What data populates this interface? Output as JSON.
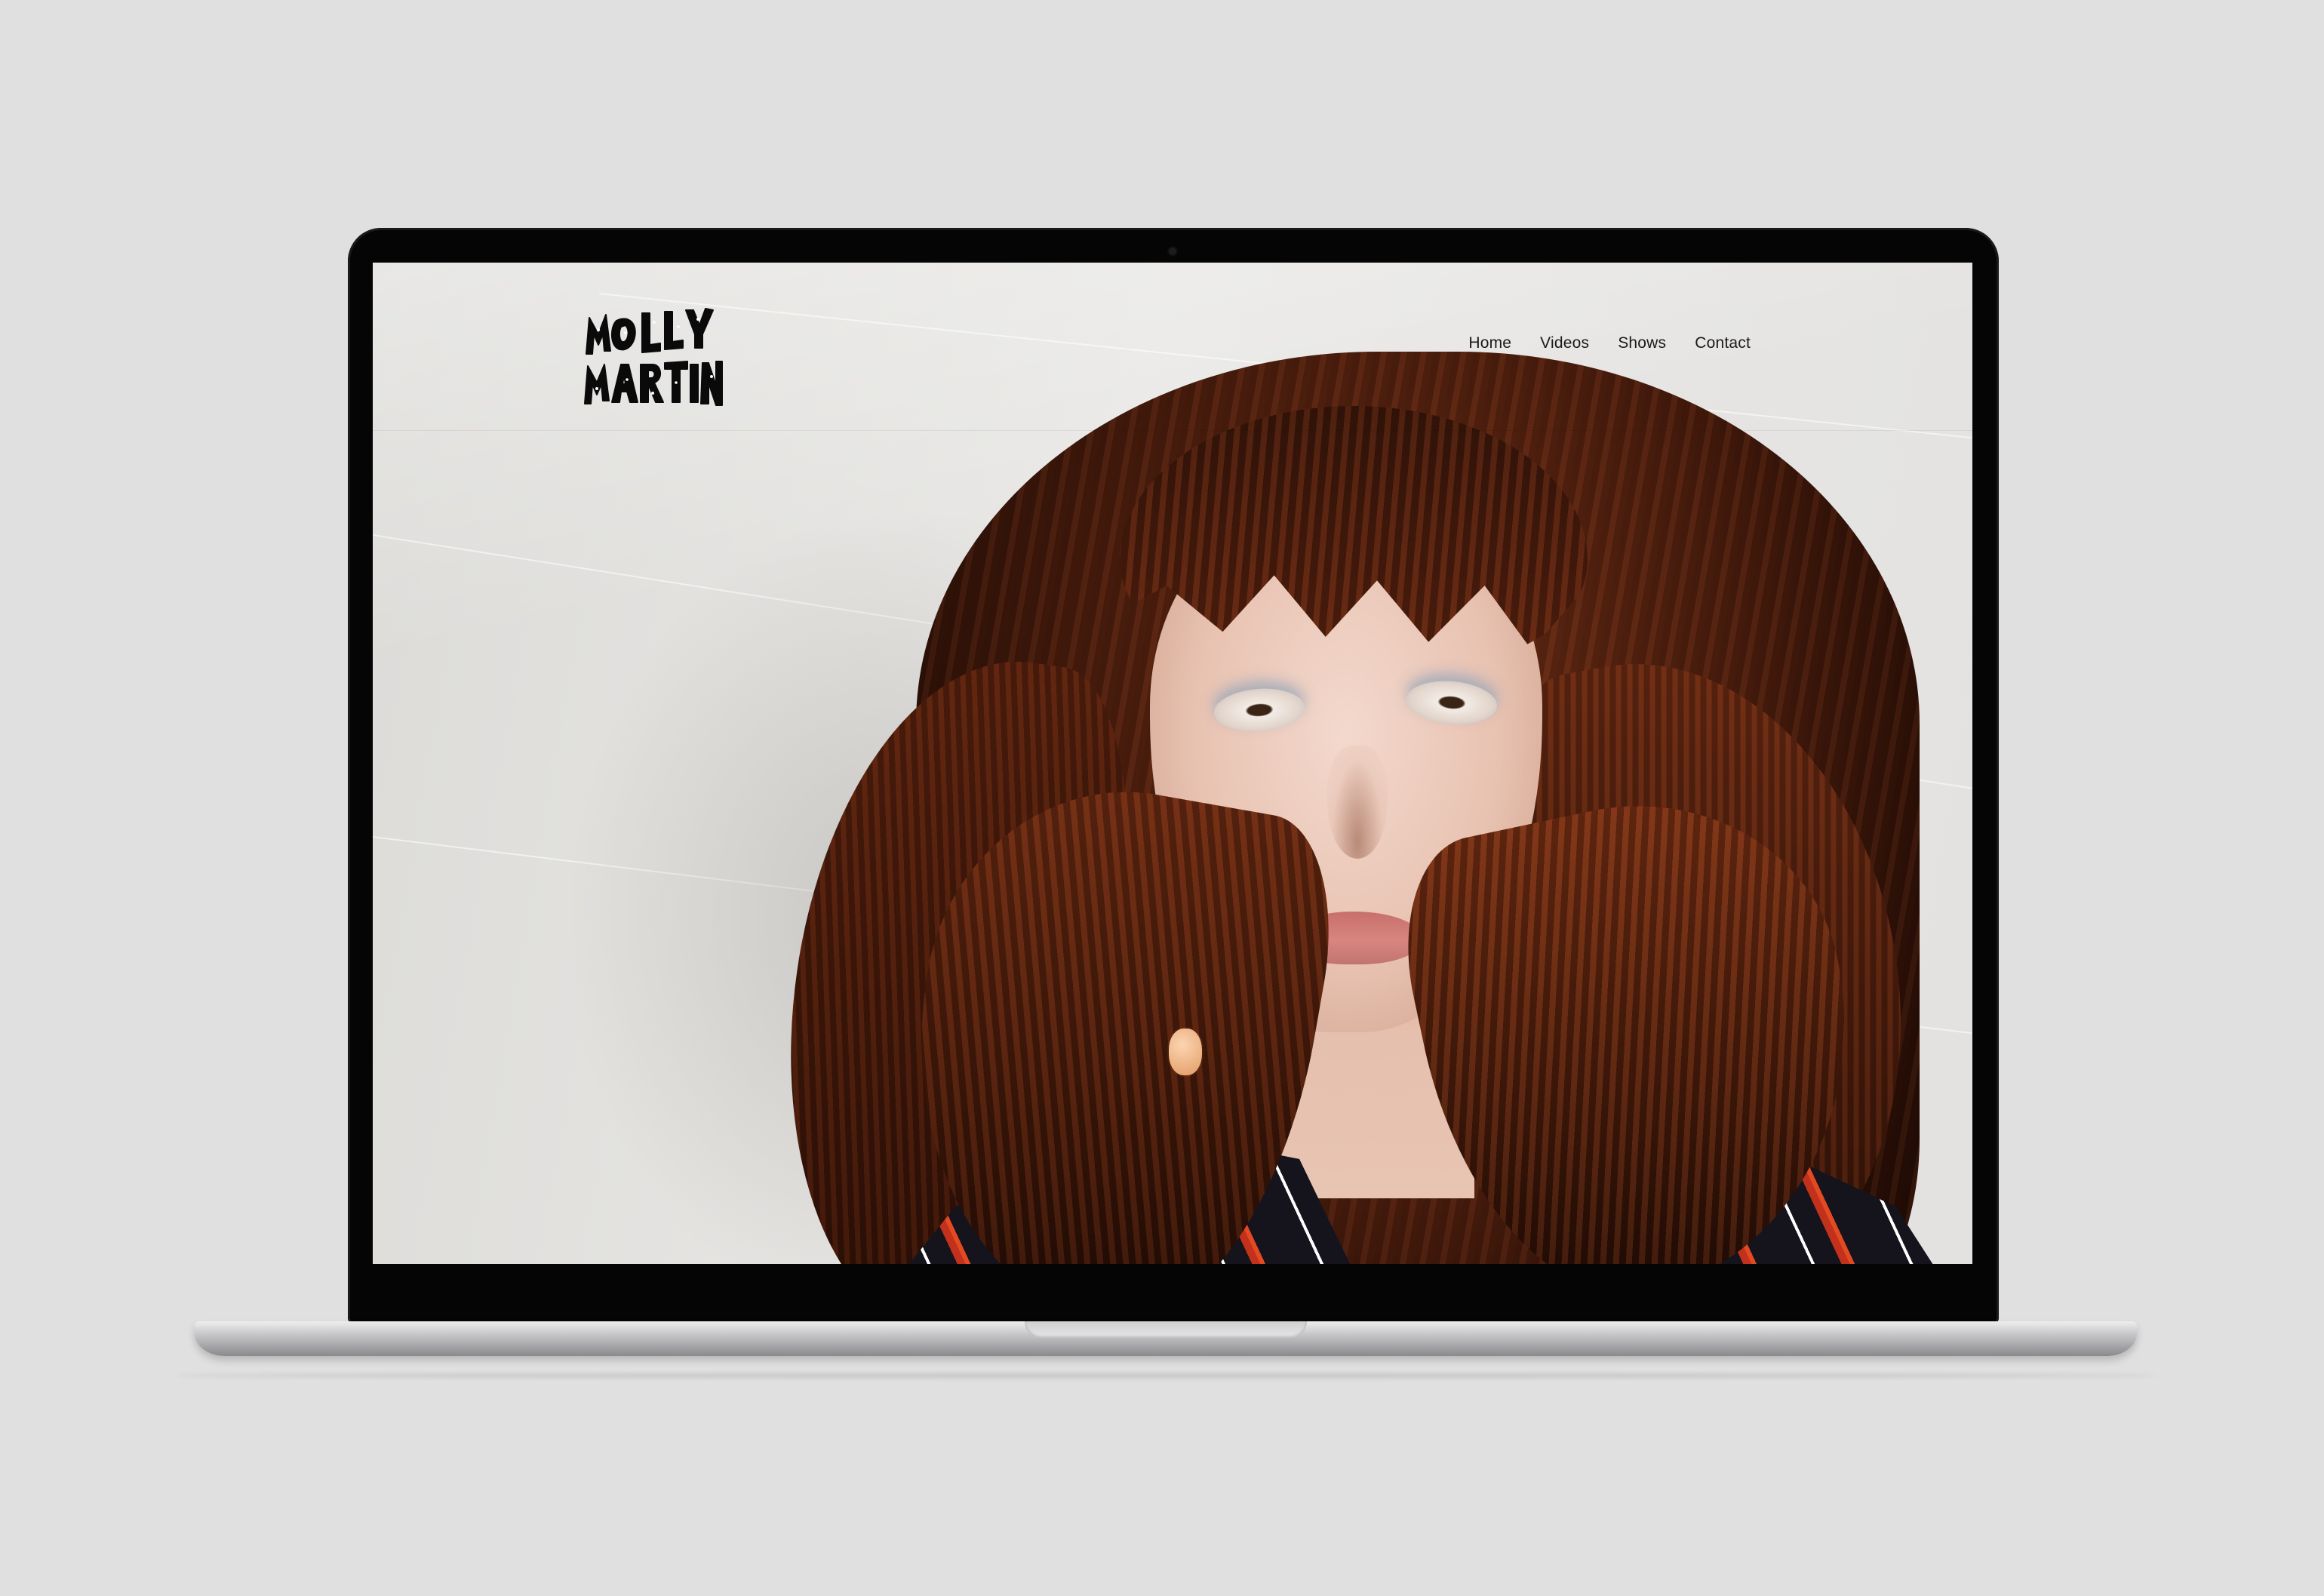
{
  "site": {
    "logo_text": "MOLLY MARTIN",
    "nav": [
      {
        "label": "Home"
      },
      {
        "label": "Videos"
      },
      {
        "label": "Shows"
      },
      {
        "label": "Contact"
      }
    ]
  },
  "colors": {
    "background": "#e0e0e0",
    "bezel": "#050505",
    "nav_text": "#1a1a1a"
  },
  "icons": {
    "logo": "molly-martin-logo",
    "camera": "webcam-dot"
  }
}
